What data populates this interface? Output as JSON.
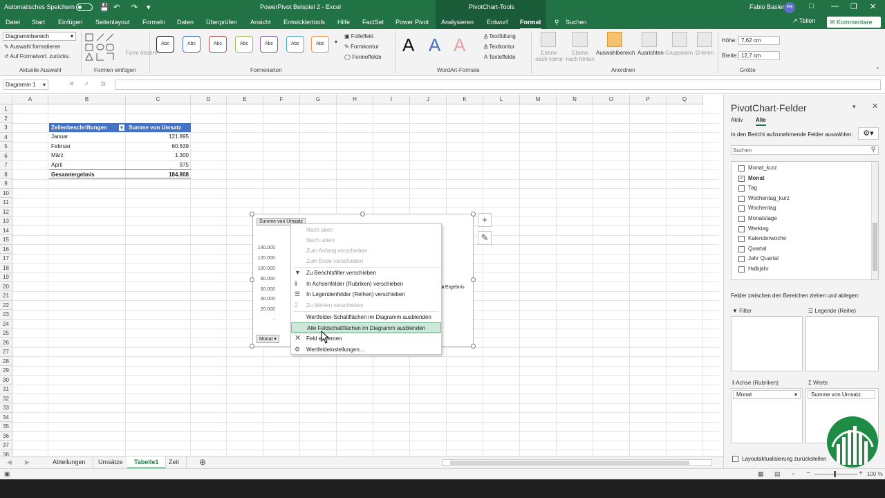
{
  "titlebar": {
    "autosave": "Automatisches Speichern",
    "doc_title": "PowerPivot Beispiel 2 - Excel",
    "context_title": "PivotChart-Tools",
    "user": "Fabio Basler",
    "avatar": "FB"
  },
  "tabs": [
    "Datei",
    "Start",
    "Einfügen",
    "Seitenlayout",
    "Formeln",
    "Daten",
    "Überprüfen",
    "Ansicht",
    "Entwicklertools",
    "Hilfe",
    "FactSet",
    "Power Pivot",
    "Analysieren",
    "Entwurf",
    "Format",
    "Suchen"
  ],
  "share_label": "Teilen",
  "comment_label": "Kommentare",
  "ribbon": {
    "chart_element": "Diagrammbereich",
    "format_selection": "Auswahl formatieren",
    "reset_format": "Auf Formatvorl. zurücks.",
    "group_current": "Aktuelle Auswahl",
    "group_insert_shapes": "Formen einfügen",
    "change_shape": "Form ändern",
    "shape_style_label": "Abc",
    "group_shape_styles": "Formenarten",
    "fill": "Fülleffekt",
    "outline": "Formkontur",
    "effects": "Formeffekte",
    "wordart_letter": "A",
    "text_fill": "Textfüllung",
    "text_outline": "Textkontur",
    "text_effects": "Texteffekte",
    "group_wordart": "WordArt-Formate",
    "bring_forward": "Ebene nach vorne",
    "send_backward": "Ebene nach hinten",
    "selection_pane": "Auswahlbereich",
    "align": "Ausrichten",
    "group": "Gruppieren",
    "rotate": "Drehen",
    "group_arrange": "Anordnen",
    "height_label": "Höhe:",
    "height_value": "7,62 cm",
    "width_label": "Breite:",
    "width_value": "12,7 cm",
    "group_size": "Größe"
  },
  "formula": {
    "namebox": "Diagramm 1",
    "fx": "fx"
  },
  "columns": [
    "A",
    "B",
    "C",
    "D",
    "E",
    "F",
    "G",
    "H",
    "I",
    "J",
    "K",
    "L",
    "M",
    "N",
    "O",
    "P",
    "Q"
  ],
  "rows": [
    "1",
    "2",
    "3",
    "4",
    "5",
    "6",
    "7",
    "8",
    "9",
    "10",
    "11",
    "12",
    "13",
    "14",
    "15",
    "16",
    "17",
    "18",
    "19",
    "20",
    "21",
    "22",
    "23",
    "24",
    "25",
    "26",
    "27",
    "28",
    "29",
    "30",
    "31",
    "32",
    "33",
    "34",
    "35",
    "36",
    "37",
    "38"
  ],
  "pivot": {
    "header_rows": "Zeilenbeschriftungen",
    "header_values": "Summe von Umsatz",
    "rows": [
      {
        "label": "Januar",
        "value": "121.895"
      },
      {
        "label": "Februar",
        "value": "60.639"
      },
      {
        "label": "März",
        "value": "1.300"
      },
      {
        "label": "April",
        "value": "975"
      }
    ],
    "total_label": "Gesamtergebnis",
    "total_value": "184.808"
  },
  "chart": {
    "value_field_button": "Summe von Umsatz",
    "axis_field_button": "Monat",
    "yticks": [
      "140.000",
      "120.000",
      "100.000",
      "80.000",
      "60.000",
      "40.000",
      "20.000",
      "-"
    ],
    "legend": "Ergebnis"
  },
  "context_menu": [
    {
      "label": "Nach oben",
      "enabled": false
    },
    {
      "label": "Nach unten",
      "enabled": false
    },
    {
      "label": "Zum Anfang verschieben",
      "enabled": false
    },
    {
      "label": "Zum Ende verschieben",
      "enabled": false
    },
    {
      "label": "Zu Berichtsfilter verschieben",
      "enabled": true
    },
    {
      "label": "In Achsenfelder (Rubriken) verschieben",
      "enabled": true
    },
    {
      "label": "In Legendenfelder (Reihen) verschieben",
      "enabled": true
    },
    {
      "label": "Zu Werten verschieben",
      "enabled": false
    },
    {
      "label": "Wertfelder-Schaltflächen im Diagramm ausblenden",
      "enabled": true
    },
    {
      "label": "Alle Feldschaltflächen im Diagramm ausblenden",
      "enabled": true
    },
    {
      "label": "Feld entfernen",
      "enabled": true
    },
    {
      "label": "Wertfeldeinstellungen...",
      "enabled": true
    }
  ],
  "pane": {
    "title": "PivotChart-Felder",
    "tab_active": "Aktiv",
    "tab_all": "Alle",
    "choose_fields": "In den Bericht aufzunehmende Felder auswählen:",
    "search_placeholder": "Suchen",
    "fields": [
      {
        "name": "Monat_kurz",
        "checked": false
      },
      {
        "name": "Monat",
        "checked": true
      },
      {
        "name": "Tag",
        "checked": false
      },
      {
        "name": "Wochentag_kurz",
        "checked": false
      },
      {
        "name": "Wochentag",
        "checked": false
      },
      {
        "name": "Monatstage",
        "checked": false
      },
      {
        "name": "Werktag",
        "checked": false
      },
      {
        "name": "Kalenderwoche",
        "checked": false
      },
      {
        "name": "Quartal",
        "checked": false
      },
      {
        "name": "Jahr Quartal",
        "checked": false
      },
      {
        "name": "Halbjahr",
        "checked": false
      }
    ],
    "drag_hint": "Felder zwischen den Bereichen ziehen und ablegen:",
    "filter_label": "Filter",
    "legend_label": "Legende (Reihe)",
    "axis_label": "Achse (Rubriken)",
    "values_label": "Werte",
    "axis_chip": "Monat",
    "values_chip": "Summe von Umsatz",
    "defer_update": "Layoutaktualisierung zurückstellen"
  },
  "sheets": [
    "Abteilungen",
    "Umsätze",
    "Tabelle1",
    "Zeit"
  ],
  "active_sheet": "Tabelle1",
  "status": {
    "zoom": "100 %"
  },
  "colors": {
    "excel_green": "#217346",
    "pivot_header": "#4472c4"
  }
}
